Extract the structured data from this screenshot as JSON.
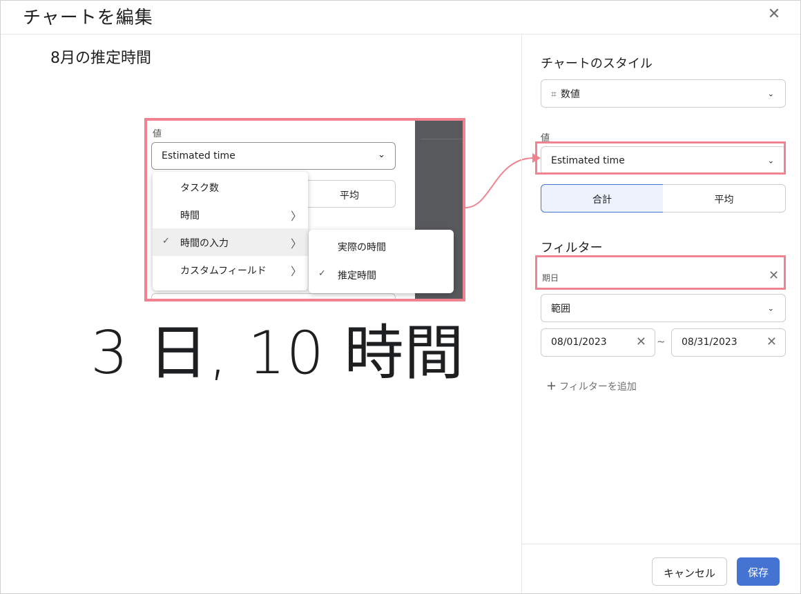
{
  "header": {
    "title": "チャートを編集",
    "close_icon": "close-icon"
  },
  "preview": {
    "chart_title": "8月の推定時間",
    "big_value": "3 日, 10 時間",
    "inset": {
      "label": "値",
      "select_value": "Estimated time",
      "average_label": "平均",
      "menu": [
        {
          "label": "タスク数",
          "checked": false,
          "submenu": false
        },
        {
          "label": "時間",
          "checked": false,
          "submenu": true
        },
        {
          "label": "時間の入力",
          "checked": true,
          "submenu": true
        },
        {
          "label": "カスタムフィールド",
          "checked": false,
          "submenu": true
        }
      ],
      "submenu": [
        {
          "label": "実際の時間",
          "checked": false
        },
        {
          "label": "推定時間",
          "checked": true
        }
      ],
      "check_glyph": "✓",
      "arrow_glyph": "〉"
    }
  },
  "sidebar": {
    "style_heading": "チャートのスタイル",
    "style_icon": "⌗",
    "style_value": "数値",
    "value_label": "値",
    "value_select": "Estimated time",
    "aggregate": {
      "sum": "合計",
      "average": "平均",
      "selected": "sum"
    },
    "filter_heading": "フィルター",
    "filter_field": "期日",
    "range_select": "範囲",
    "date_from": "08/01/2023",
    "date_to": "08/31/2023",
    "tilde": "~",
    "add_filter": "フィルターを追加"
  },
  "footer": {
    "cancel": "キャンセル",
    "save": "保存"
  },
  "colors": {
    "highlight": "#f0838f",
    "primary": "#4573d2",
    "selected_bg": "#edf2fc"
  }
}
